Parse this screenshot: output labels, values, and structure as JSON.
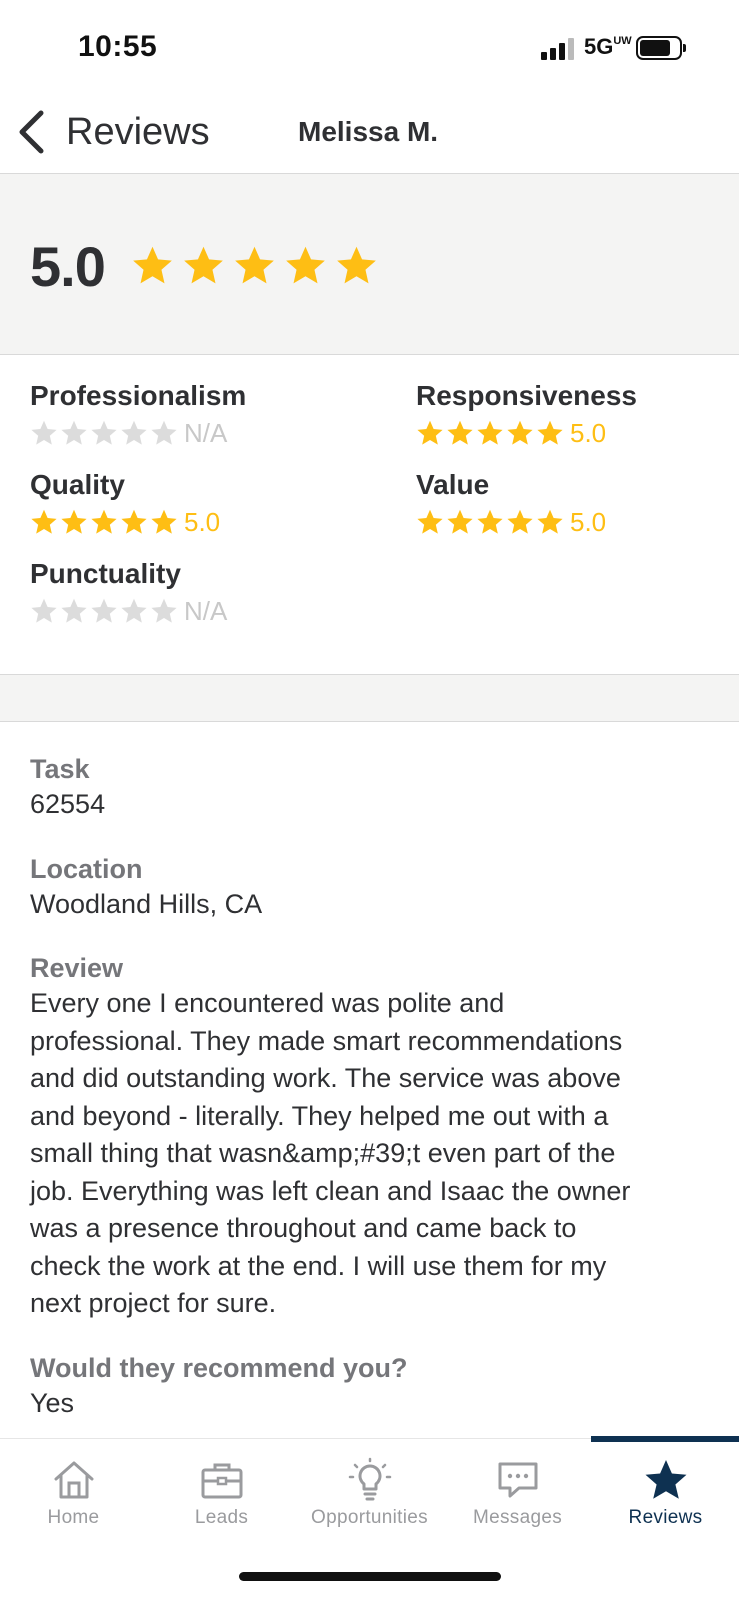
{
  "status_bar": {
    "time": "10:55",
    "network": "5G",
    "network_sup": "UW"
  },
  "nav": {
    "back_label": "Reviews",
    "title": "Melissa M."
  },
  "overall": {
    "score": "5.0",
    "stars": 5
  },
  "categories": [
    {
      "label": "Professionalism",
      "value": "N/A",
      "stars": 0
    },
    {
      "label": "Responsiveness",
      "value": "5.0",
      "stars": 5
    },
    {
      "label": "Quality",
      "value": "5.0",
      "stars": 5
    },
    {
      "label": "Value",
      "value": "5.0",
      "stars": 5
    },
    {
      "label": "Punctuality",
      "value": "N/A",
      "stars": 0
    }
  ],
  "details": {
    "task_label": "Task",
    "task_value": "62554",
    "location_label": "Location",
    "location_value": "Woodland Hills, CA",
    "review_label": "Review",
    "review_lines": [
      "Every one I encountered was polite and",
      "professional. They made smart recommendations",
      "and did outstanding work. The service was above",
      "and beyond - literally. They helped me out with a",
      "small thing that wasn&amp;#39;t even part of the",
      "job. Everything was left clean and Isaac the owner",
      "was a presence throughout and came back to",
      "check the work at the end. I will use them for my",
      "next project for sure."
    ],
    "recommend_label": "Would they recommend you?",
    "recommend_value": "Yes"
  },
  "tabs": [
    {
      "label": "Home",
      "icon": "home-icon",
      "active": false
    },
    {
      "label": "Leads",
      "icon": "briefcase-icon",
      "active": false
    },
    {
      "label": "Opportunities",
      "icon": "lightbulb-icon",
      "active": false
    },
    {
      "label": "Messages",
      "icon": "chat-icon",
      "active": false
    },
    {
      "label": "Reviews",
      "icon": "star-icon",
      "active": true
    }
  ],
  "colors": {
    "star_filled": "#febe14",
    "star_empty": "#dcdcdc",
    "active_tab": "#0e3151",
    "inactive_tab": "#9a9b9e",
    "band": "#f4f4f3"
  }
}
